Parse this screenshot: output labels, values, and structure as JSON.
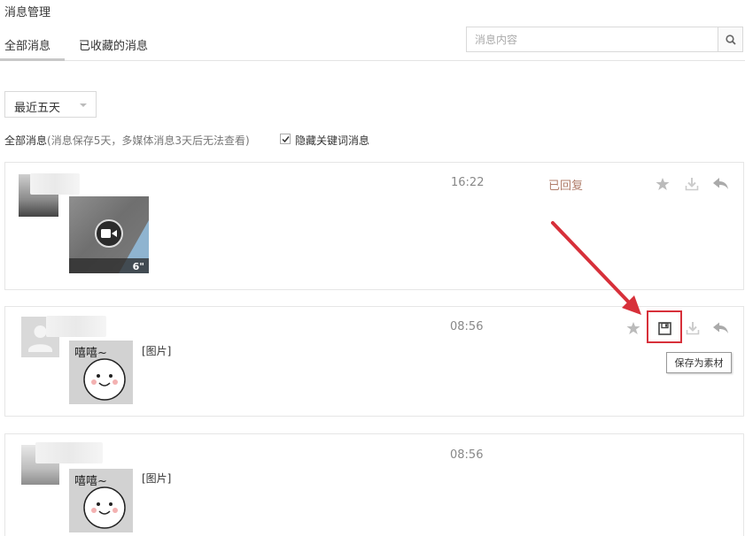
{
  "page": {
    "title": "消息管理"
  },
  "tabs": [
    {
      "label": "全部消息",
      "active": true
    },
    {
      "label": "已收藏的消息",
      "active": false
    }
  ],
  "search": {
    "placeholder": "消息内容",
    "value": ""
  },
  "filter": {
    "range_selected": "最近五天",
    "summary_label": "全部消息",
    "summary_note": "(消息保存5天，多媒体消息3天后无法查看)",
    "hide_keyword_label": "隐藏关键词消息",
    "hide_keyword_checked": true
  },
  "messages": [
    {
      "time": "16:22",
      "status": "已回复",
      "type": "video",
      "video_duration": "6\"",
      "text": ""
    },
    {
      "time": "08:56",
      "status": "",
      "type": "image",
      "text": "[图片]"
    },
    {
      "time": "08:56",
      "status": "",
      "type": "image",
      "text": "[图片]"
    }
  ],
  "tooltip": {
    "label": "保存为素材"
  },
  "colors": {
    "status": "#b07d6a",
    "annotation_red": "#d7303a",
    "border": "#e6e6e6"
  },
  "icons": [
    "search-icon",
    "star-icon",
    "download-icon",
    "reply-icon",
    "save-icon",
    "video-camera-icon",
    "check-icon"
  ]
}
